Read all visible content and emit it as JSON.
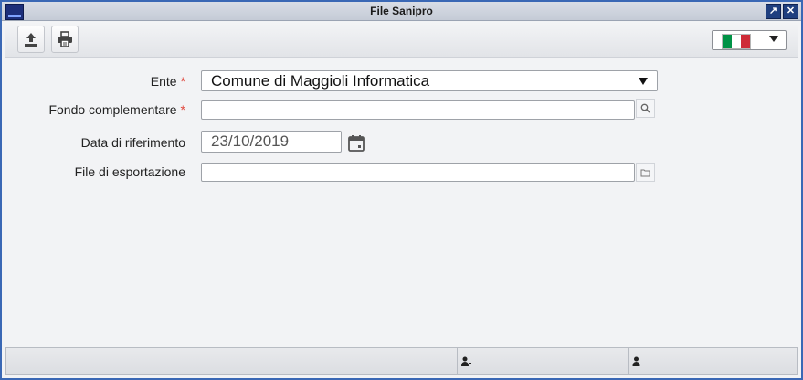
{
  "window": {
    "title": "File Sanipro",
    "maximize_glyph": "↗",
    "close_glyph": "✕"
  },
  "toolbar": {
    "export_icon": "upload-icon",
    "print_icon": "printer-icon",
    "language_flag_colors": [
      "#009246",
      "#ffffff",
      "#ce2b37"
    ]
  },
  "form": {
    "ente": {
      "label": "Ente",
      "required_mark": "*",
      "value": "Comune di Maggioli Informatica"
    },
    "fondo": {
      "label": "Fondo complementare",
      "required_mark": "*",
      "value": ""
    },
    "data": {
      "label": "Data di riferimento",
      "value": "23/10/2019"
    },
    "file": {
      "label": "File di esportazione",
      "value": ""
    }
  },
  "colors": {
    "required": "#e0463c",
    "title_bar_border": "#3a68b5"
  }
}
